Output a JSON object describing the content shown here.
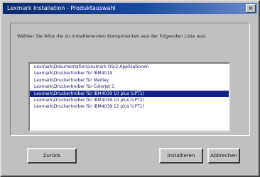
{
  "window": {
    "title": "Lexmark Installation - Produktauswahl",
    "close_glyph": "×"
  },
  "instruction": "Wählen Sie bitte die zu installierenden Komponenten aus der folgenden Liste aus:",
  "list": {
    "items": [
      {
        "label": "Lexmark\\Dokumentation\\Lexmark OS/2-Applikationen",
        "selected": false
      },
      {
        "label": "Lexmark\\Druckertreiber für IBM4019",
        "selected": false
      },
      {
        "label": "Lexmark\\Druckertreiber für Medley",
        "selected": false
      },
      {
        "label": "Lexmark\\Druckertreiber für ColorJet 5",
        "selected": false
      },
      {
        "label": "Lexmark\\Druckertreiber für IBM4039 10 plus (LPT1)",
        "selected": true
      },
      {
        "label": "Lexmark\\Druckertreiber für IBM4039 10 plus (LPT2)",
        "selected": false
      },
      {
        "label": "Lexmark\\Druckertreiber für IBM4039 12 plus (LPT1)",
        "selected": false
      }
    ]
  },
  "buttons": {
    "back": "Zurück",
    "install": "Installieren",
    "cancel": "Abbrechen"
  },
  "colors": {
    "selection": "#11248a",
    "titlebar": "#0a2a6a",
    "face": "#c0c0c0"
  }
}
